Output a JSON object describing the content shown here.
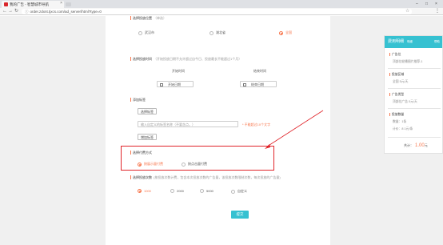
{
  "browser": {
    "tab_title": "我的广告 - 智慧城市导航",
    "url": "order.zdxnt.tjxcs.com/ad_server/html?type=0"
  },
  "ad_position": {
    "label": "选择投放位置",
    "hint": "（单选）",
    "options": [
      "武汉市",
      "湖北省",
      "全国"
    ],
    "selected": 2
  },
  "ad_time": {
    "label": "选择投放时间",
    "hint": "（开始投放日期不允许超过自今日、投放最长不能超过1个月）",
    "start_head": "开始时间",
    "end_head": "结束时间",
    "start_placeholder": "开始日期",
    "end_placeholder": "结束日期"
  },
  "ad_tags": {
    "label": "添加标签",
    "select_btn": "选择标签",
    "input_placeholder": "输入自定义的标签名称（不要含点。）",
    "warn": "* 不能超过10个文字",
    "add_btn": "增加标签"
  },
  "billing": {
    "label": "选择付费方式",
    "options": [
      "按展示量付费",
      "按点击量付费"
    ],
    "selected": 0
  },
  "impressions": {
    "label": "选择投放次数",
    "hint": "(按投放次数计费，包含本次投放次数的广告量，该投放次数限制次数，每次投放的广告量)",
    "options": [
      "1000",
      "2000",
      "5000",
      "自定义"
    ],
    "selected": 0
  },
  "submit_label": "提交",
  "panel": {
    "title": "费用明细",
    "subtitle": "明细",
    "help": "帮助",
    "sections": [
      {
        "title": "广告位",
        "value": "顶部位轮播图片推荐-1"
      },
      {
        "title": "投放区域",
        "value": "全国    5元/天"
      },
      {
        "title": "广告类型",
        "value": "顶部位广告  0元/天"
      },
      {
        "title": "投放数量",
        "value": "数量：1条"
      }
    ],
    "extra": "计价：8    1元/条",
    "total_label": "共计：",
    "total_value": "1.00",
    "total_unit": "元"
  },
  "colors": {
    "accent": "#f7754b",
    "primary": "#36c1d1",
    "highlight": "#e0242a"
  }
}
